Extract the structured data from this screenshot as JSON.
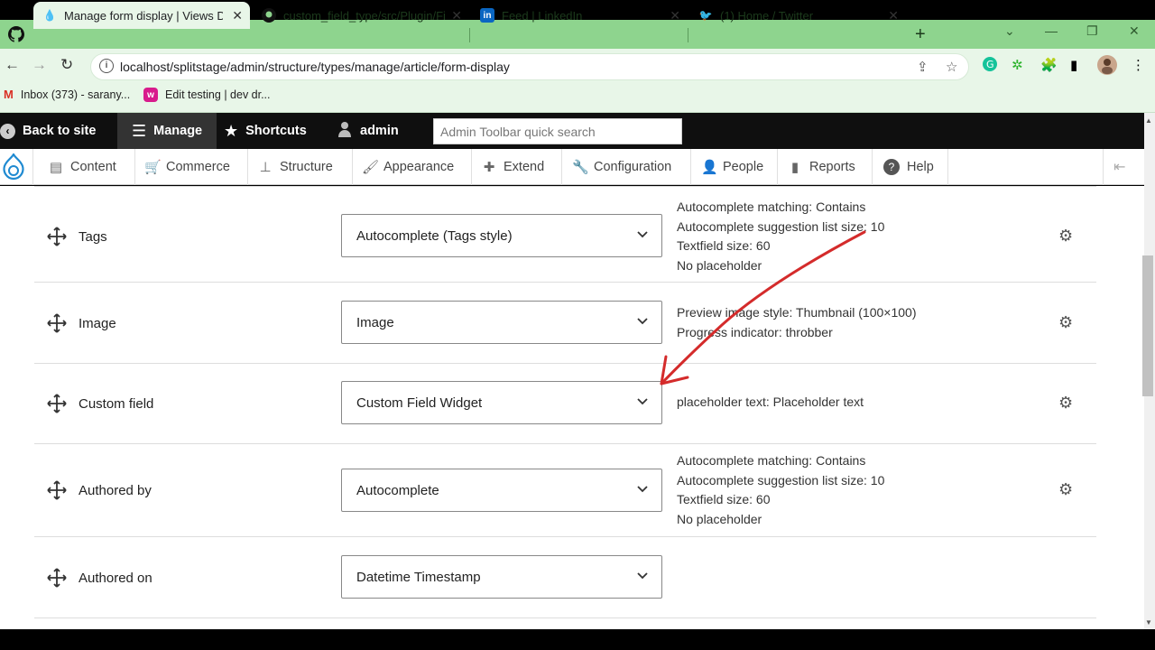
{
  "browser": {
    "tabs": [
      {
        "title": "Manage form display | Views Der",
        "active": true
      },
      {
        "title": "custom_field_type/src/Plugin/Fie"
      },
      {
        "title": "Feed | LinkedIn"
      },
      {
        "title": "(1) Home / Twitter"
      }
    ],
    "url": "localhost/splitstage/admin/structure/types/manage/article/form-display",
    "bookmarks": [
      {
        "label": "Inbox (373) - sarany..."
      },
      {
        "label": "Edit testing | dev dr..."
      }
    ]
  },
  "admin_toolbar": {
    "back_to_site": "Back to site",
    "manage": "Manage",
    "shortcuts": "Shortcuts",
    "user": "admin",
    "search_placeholder": "Admin Toolbar quick search"
  },
  "menu": {
    "items": [
      "Content",
      "Commerce",
      "Structure",
      "Appearance",
      "Extend",
      "Configuration",
      "People",
      "Reports",
      "Help"
    ]
  },
  "fields": [
    {
      "name": "Tags",
      "widget": "Autocomplete (Tags style)",
      "summary": [
        "Autocomplete matching: Contains",
        "Autocomplete suggestion list size: 10",
        "Textfield size: 60",
        "No placeholder"
      ]
    },
    {
      "name": "Image",
      "widget": "Image",
      "summary": [
        "Preview image style: Thumbnail (100×100)",
        "Progress indicator: throbber"
      ]
    },
    {
      "name": "Custom field",
      "widget": "Custom Field Widget",
      "summary": [
        "placeholder text: Placeholder text"
      ]
    },
    {
      "name": "Authored by",
      "widget": "Autocomplete",
      "summary": [
        "Autocomplete matching: Contains",
        "Autocomplete suggestion list size: 10",
        "Textfield size: 60",
        "No placeholder"
      ]
    },
    {
      "name": "Authored on",
      "widget": "Datetime Timestamp",
      "summary": []
    }
  ],
  "colors": {
    "browser_frame": "#8ed48e",
    "annotation_arrow": "#d42b2b"
  }
}
